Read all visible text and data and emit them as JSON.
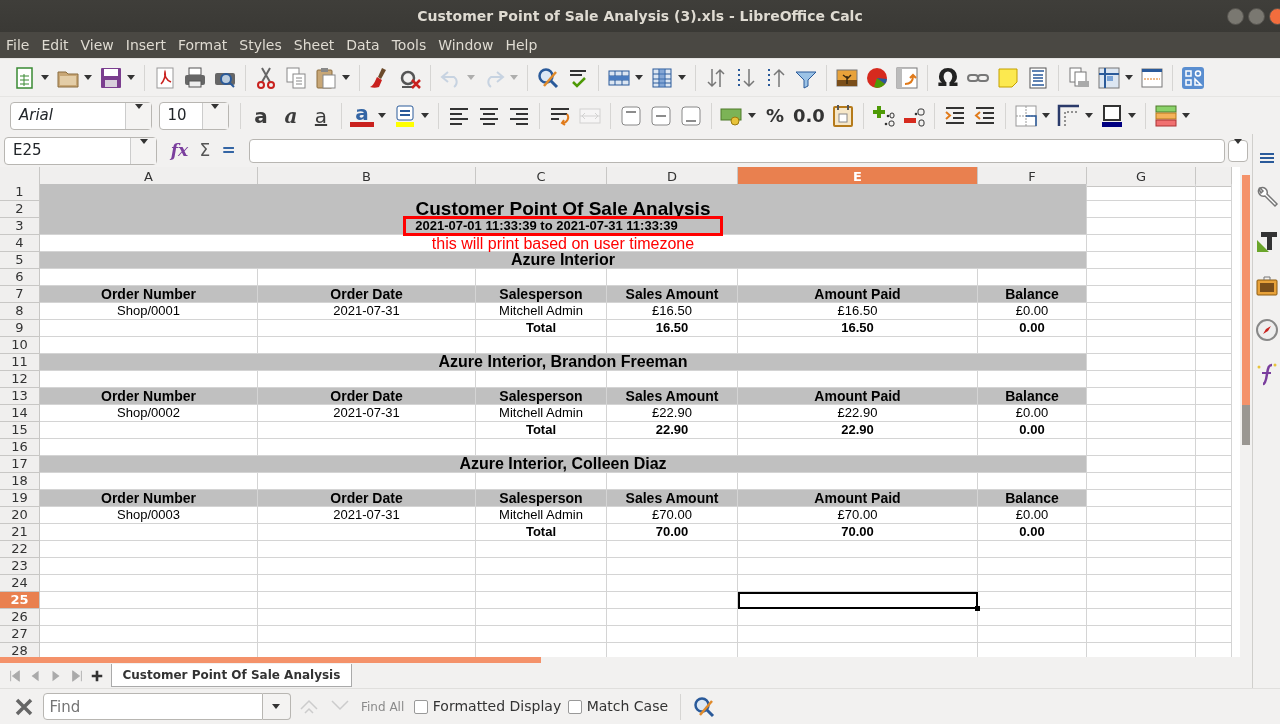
{
  "window": {
    "title": "Customer Point of Sale Analysis (3).xls - LibreOffice Calc"
  },
  "menu": [
    "File",
    "Edit",
    "View",
    "Insert",
    "Format",
    "Styles",
    "Sheet",
    "Data",
    "Tools",
    "Window",
    "Help"
  ],
  "toolbar_standard": [
    {
      "kind": "new-sheet",
      "dropdown": true
    },
    {
      "kind": "open",
      "dropdown": true
    },
    {
      "kind": "save",
      "dropdown": true
    },
    {
      "kind": "sep"
    },
    {
      "kind": "pdf"
    },
    {
      "kind": "print"
    },
    {
      "kind": "preview"
    },
    {
      "kind": "sep"
    },
    {
      "kind": "cut"
    },
    {
      "kind": "copy"
    },
    {
      "kind": "paste",
      "dropdown": true
    },
    {
      "kind": "sep"
    },
    {
      "kind": "brush"
    },
    {
      "kind": "clear"
    },
    {
      "kind": "sep"
    },
    {
      "kind": "undo",
      "dropdown": true,
      "disabled": true
    },
    {
      "kind": "redo",
      "dropdown": true,
      "disabled": true
    },
    {
      "kind": "sep"
    },
    {
      "kind": "find-replace"
    },
    {
      "kind": "spelling"
    },
    {
      "kind": "sep"
    },
    {
      "kind": "rows",
      "dropdown": true
    },
    {
      "kind": "columns",
      "dropdown": true
    },
    {
      "kind": "sep"
    },
    {
      "kind": "sort"
    },
    {
      "kind": "sort-asc"
    },
    {
      "kind": "sort-desc"
    },
    {
      "kind": "filter"
    },
    {
      "kind": "sep"
    },
    {
      "kind": "image"
    },
    {
      "kind": "chart"
    },
    {
      "kind": "pivot"
    },
    {
      "kind": "sep"
    },
    {
      "kind": "omega",
      "glyph": "Ω"
    },
    {
      "kind": "link"
    },
    {
      "kind": "note"
    },
    {
      "kind": "header-footer"
    },
    {
      "kind": "sep"
    },
    {
      "kind": "print-area"
    },
    {
      "kind": "freeze",
      "dropdown": true
    },
    {
      "kind": "split"
    },
    {
      "kind": "sep"
    },
    {
      "kind": "form"
    }
  ],
  "font_name": "Arial",
  "font_size": "10",
  "toolbar_format": [
    {
      "kind": "sep"
    },
    {
      "kind": "bold",
      "glyph": "a"
    },
    {
      "kind": "italic",
      "glyph": "a"
    },
    {
      "kind": "underline",
      "glyph": "a"
    },
    {
      "kind": "sep"
    },
    {
      "kind": "font-color",
      "glyph": "a",
      "dropdown": true
    },
    {
      "kind": "highlight",
      "dropdown": true
    },
    {
      "kind": "sep"
    },
    {
      "kind": "align-left"
    },
    {
      "kind": "align-center"
    },
    {
      "kind": "align-right"
    },
    {
      "kind": "sep"
    },
    {
      "kind": "wrap"
    },
    {
      "kind": "merge",
      "disabled": true
    },
    {
      "kind": "sep"
    },
    {
      "kind": "valign-top"
    },
    {
      "kind": "valign-center"
    },
    {
      "kind": "valign-bottom"
    },
    {
      "kind": "sep"
    },
    {
      "kind": "currency",
      "dropdown": true
    },
    {
      "kind": "percent",
      "glyph": "%"
    },
    {
      "kind": "number",
      "glyph": "0.0"
    },
    {
      "kind": "date"
    },
    {
      "kind": "sep"
    },
    {
      "kind": "add-decimal"
    },
    {
      "kind": "delete-decimal"
    },
    {
      "kind": "sep"
    },
    {
      "kind": "indent-more"
    },
    {
      "kind": "indent-less"
    },
    {
      "kind": "sep"
    },
    {
      "kind": "borders",
      "dropdown": true
    },
    {
      "kind": "border-style",
      "dropdown": true
    },
    {
      "kind": "border-color",
      "dropdown": true
    },
    {
      "kind": "sep"
    },
    {
      "kind": "conditional",
      "dropdown": true
    }
  ],
  "name_box": "E25",
  "formula_tools": [
    {
      "kind": "wizard",
      "glyph": "fx"
    },
    {
      "kind": "sum",
      "glyph": "Σ"
    },
    {
      "kind": "formula",
      "glyph": "="
    }
  ],
  "columns": [
    {
      "label": "A",
      "selected": false
    },
    {
      "label": "B",
      "selected": false
    },
    {
      "label": "C",
      "selected": false
    },
    {
      "label": "D",
      "selected": false
    },
    {
      "label": "E",
      "selected": true
    },
    {
      "label": "F",
      "selected": false
    },
    {
      "label": "G",
      "selected": false
    }
  ],
  "rows": [
    {
      "number": "1",
      "selected": false,
      "kind": "band"
    },
    {
      "number": "2",
      "selected": false,
      "kind": "title",
      "text": "Customer Point Of Sale Analysis"
    },
    {
      "number": "3",
      "selected": false,
      "kind": "subtitle",
      "text": "2021-07-01 11:33:39 to 2021-07-31 11:33:39",
      "outlined": true
    },
    {
      "number": "4",
      "selected": false,
      "kind": "note",
      "text": "this will print based on user timezone"
    },
    {
      "number": "5",
      "selected": false,
      "kind": "group",
      "text": "Azure Interior"
    },
    {
      "number": "6",
      "selected": false,
      "kind": "empty"
    },
    {
      "number": "7",
      "selected": false,
      "kind": "header",
      "cells": [
        "Order Number",
        "Order Date",
        "Salesperson",
        "Sales Amount",
        "Amount Paid",
        "Balance"
      ]
    },
    {
      "number": "8",
      "selected": false,
      "kind": "data",
      "cells": [
        "Shop/0001",
        "2021-07-31",
        "Mitchell Admin",
        "£16.50",
        "£16.50",
        "£0.00"
      ]
    },
    {
      "number": "9",
      "selected": false,
      "kind": "total",
      "cells": [
        "Total",
        "16.50",
        "16.50",
        "0.00"
      ]
    },
    {
      "number": "10",
      "selected": false,
      "kind": "empty"
    },
    {
      "number": "11",
      "selected": false,
      "kind": "group",
      "text": "Azure Interior, Brandon Freeman"
    },
    {
      "number": "12",
      "selected": false,
      "kind": "empty"
    },
    {
      "number": "13",
      "selected": false,
      "kind": "header",
      "cells": [
        "Order Number",
        "Order Date",
        "Salesperson",
        "Sales Amount",
        "Amount Paid",
        "Balance"
      ]
    },
    {
      "number": "14",
      "selected": false,
      "kind": "data",
      "cells": [
        "Shop/0002",
        "2021-07-31",
        "Mitchell Admin",
        "£22.90",
        "£22.90",
        "£0.00"
      ]
    },
    {
      "number": "15",
      "selected": false,
      "kind": "total",
      "cells": [
        "Total",
        "22.90",
        "22.90",
        "0.00"
      ]
    },
    {
      "number": "16",
      "selected": false,
      "kind": "empty"
    },
    {
      "number": "17",
      "selected": false,
      "kind": "group",
      "text": "Azure Interior, Colleen Diaz"
    },
    {
      "number": "18",
      "selected": false,
      "kind": "empty"
    },
    {
      "number": "19",
      "selected": false,
      "kind": "header",
      "cells": [
        "Order Number",
        "Order Date",
        "Salesperson",
        "Sales Amount",
        "Amount Paid",
        "Balance"
      ]
    },
    {
      "number": "20",
      "selected": false,
      "kind": "data",
      "cells": [
        "Shop/0003",
        "2021-07-31",
        "Mitchell Admin",
        "£70.00",
        "£70.00",
        "£0.00"
      ]
    },
    {
      "number": "21",
      "selected": false,
      "kind": "total",
      "cells": [
        "Total",
        "70.00",
        "70.00",
        "0.00"
      ]
    },
    {
      "number": "22",
      "selected": false,
      "kind": "empty"
    },
    {
      "number": "23",
      "selected": false,
      "kind": "empty"
    },
    {
      "number": "24",
      "selected": false,
      "kind": "empty"
    },
    {
      "number": "25",
      "selected": true,
      "kind": "empty"
    },
    {
      "number": "26",
      "selected": false,
      "kind": "empty"
    },
    {
      "number": "27",
      "selected": false,
      "kind": "empty"
    },
    {
      "number": "28",
      "selected": false,
      "kind": "empty"
    }
  ],
  "sheet_tabs": [
    {
      "label": "Customer Point Of Sale Analysis",
      "selected": true
    }
  ],
  "find_bar": {
    "placeholder": "Find",
    "find_all": "Find All",
    "options": [
      {
        "label": "Formatted Display",
        "checked": false
      },
      {
        "label": "Match Case",
        "checked": false
      }
    ]
  }
}
